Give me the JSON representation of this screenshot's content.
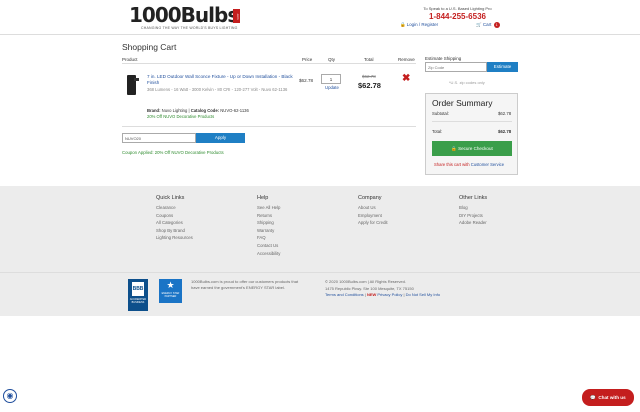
{
  "header": {
    "logo_text": "1000Bulbs",
    "logo_com": ".com",
    "logo_tagline": "CHANGING THE WAY THE WORLD'S BUYS LIGHTING",
    "phone_label": "To Speak to a U.S. Based Lighting Pro",
    "phone_number": "1-844-255-6536",
    "login_register": "Login / Register",
    "cart_label": "Cart",
    "cart_count": "1"
  },
  "cart": {
    "title": "Shopping Cart",
    "columns": {
      "product": "Product",
      "price": "Price",
      "qty": "Qty",
      "total": "Total",
      "remove": "Remove"
    },
    "item": {
      "title": "7 in. LED Outdoor Wall Sconce Fixture - Up or Down Installation - Black Finish",
      "specs": "368 Lumens - 16 Watt - 3000 Kelvin - 80 CRI - 120-277 Volt - Nuvo 62-1136",
      "brand_label": "Brand:",
      "brand": "Nuvo Lighting",
      "catalog_label": "Catalog Code:",
      "catalog": "NUVO-62-1136",
      "promo": "20% Off NUVO Decorative Products",
      "price": "$62.78",
      "qty": "1",
      "update": "Update",
      "old_total": "$62.78",
      "total": "$62.78"
    },
    "coupon_value": "NUVO20",
    "apply_label": "Apply",
    "coupon_message": "Coupon Applied: 20% Off NUVO Decorative Products"
  },
  "sidebar": {
    "estimate_label": "Estimate  Shipping",
    "zip_placeholder": "Zip Code",
    "estimate_button": "Estimate",
    "zip_note": "*U.S. zip codes only",
    "summary_title": "Order Summary",
    "subtotal_label": "Subtotal:",
    "subtotal_value": "$62.78",
    "total_label": "Total:",
    "total_value": "$62.78",
    "checkout_label": "Secure Checkout",
    "share_prefix": "Share this cart with",
    "share_link": "Customer Service"
  },
  "footer": {
    "quick_links": {
      "heading": "Quick Links",
      "items": [
        "Clearance",
        "Coupons",
        "All Categories",
        "Shop By Brand",
        "Lighting Resources"
      ]
    },
    "help": {
      "heading": "Help",
      "items": [
        "See All Help",
        "Returns",
        "Shipping",
        "Warranty",
        "FAQ",
        "Contact Us",
        "Accessibility"
      ]
    },
    "company": {
      "heading": "Company",
      "items": [
        "About Us",
        "Employment",
        "Apply for Credit"
      ]
    },
    "other_links": {
      "heading": "Other Links",
      "items": [
        "Blog",
        "DIY Projects",
        "Adobe Reader"
      ]
    },
    "bbb_label": "BBB",
    "bbb_sub": "ACCREDITED BUSINESS",
    "energy_star_label": "ENERGY STAR PARTNER",
    "energy_text": "1000Bulbs.com is proud to offer our customers products that have earned the government's ENERGY STAR label.",
    "copyright": "© 2020 1000Bulbs.com | All Rights Reserved.",
    "address": "1475 Republic Pkwy. Ste 100 Mesquite, TX 75150",
    "terms": "Terms and Conditions",
    "new_tag": "NEW",
    "privacy": "Privacy Policy",
    "do_not_sell": "Do Not Sell My Info"
  },
  "widgets": {
    "chat_label": "Chat with us"
  }
}
